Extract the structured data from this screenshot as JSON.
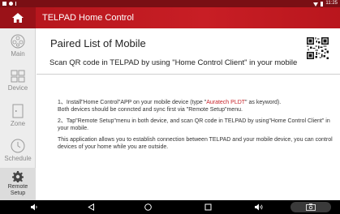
{
  "status_bar": {
    "time": "11:25",
    "left_icons": [
      "notification-icon",
      "android-icon",
      "alert-icon"
    ],
    "right_icons": [
      "wifi-icon",
      "battery-icon"
    ]
  },
  "app": {
    "title": "TELPAD Home Control",
    "home_icon": "home-icon",
    "accent_color": "#c81e25"
  },
  "sidebar": {
    "items": [
      {
        "label": "Main",
        "icon": "main-icon",
        "active": false
      },
      {
        "label": "Device",
        "icon": "device-icon",
        "active": false
      },
      {
        "label": "Zone",
        "icon": "zone-icon",
        "active": false
      },
      {
        "label": "Schedule",
        "icon": "schedule-icon",
        "active": false
      },
      {
        "label": "Remote Setup",
        "icon": "gear-icon",
        "active": true
      }
    ]
  },
  "main": {
    "title": "Paired List of Mobile",
    "subtitle": "Scan QR code in TELPAD by using \"Home Control Client\" in your mobile",
    "instructions": {
      "step1_pre": "1、Install\"Home Control\"APP on your mobile device  (type \"",
      "step1_keyword": "Auratech PLDT",
      "step1_post": "\" as keyword).",
      "step1_line2": "Both devices should be conncted and sync first via \"Remote Setup\"menu.",
      "step2": "2、Tap\"Remote Setup\"menu in both device, and scan QR code in TELPAD by using\"Home Control Client\" in your mobile.",
      "note": "This application allows you to establish connection between TELPAD and your mobile device, you can control devices of your home while you are outside."
    }
  },
  "navbar": {
    "buttons": [
      "volume-down-icon",
      "back-icon",
      "home-circle-icon",
      "recents-icon",
      "volume-up-icon",
      "camera-icon"
    ]
  }
}
